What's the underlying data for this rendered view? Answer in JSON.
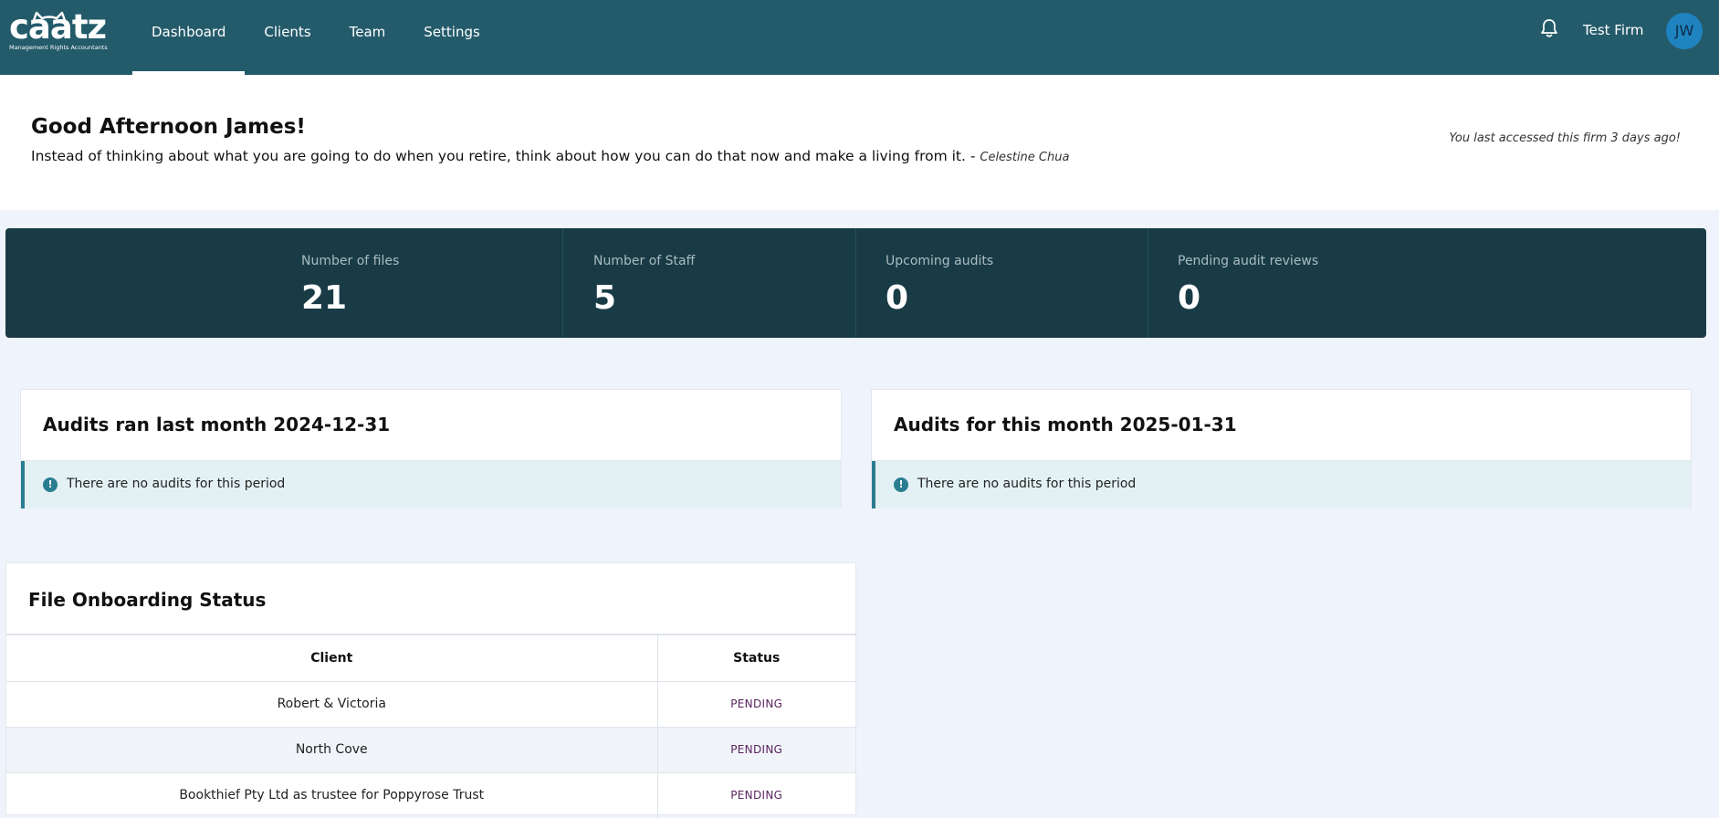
{
  "header": {
    "logo_text": "caatz",
    "logo_tagline": "Management Rights Accountants",
    "nav": [
      {
        "label": "Dashboard",
        "active": true
      },
      {
        "label": "Clients",
        "active": false
      },
      {
        "label": "Team",
        "active": false
      },
      {
        "label": "Settings",
        "active": false
      }
    ],
    "notification_icon": "bell-icon",
    "firm_name": "Test Firm",
    "avatar_initials": "JW"
  },
  "greeting": {
    "title": "Good Afternoon James!",
    "quote": "Instead of thinking about what you are going to do when you retire, think about how you can do that now and make a living from it. -",
    "quote_author": "Celestine Chua",
    "last_access": "You last accessed this firm 3 days ago!"
  },
  "stats": [
    {
      "label": "Number of files",
      "value": "21"
    },
    {
      "label": "Number of Staff",
      "value": "5"
    },
    {
      "label": "Upcoming audits",
      "value": "0"
    },
    {
      "label": "Pending audit reviews",
      "value": "0"
    }
  ],
  "audits_last_month": {
    "title": "Audits ran last month 2024-12-31",
    "empty_message": "There are no audits for this period"
  },
  "audits_this_month": {
    "title": "Audits for this month 2025-01-31",
    "empty_message": "There are no audits for this period"
  },
  "file_onboarding": {
    "title": "File Onboarding Status",
    "columns": [
      "Client",
      "Status"
    ],
    "rows": [
      {
        "client": "Robert & Victoria",
        "status": "PENDING"
      },
      {
        "client": "North Cove",
        "status": "PENDING"
      },
      {
        "client": "Bookthief Pty Ltd as trustee for Poppyrose Trust",
        "status": "PENDING"
      }
    ]
  },
  "colors": {
    "topbar": "#245b6b",
    "stats_bg": "#193b45",
    "info_accent": "#2a7d91",
    "pending": "#5b2461",
    "avatar": "#1f83c0"
  }
}
